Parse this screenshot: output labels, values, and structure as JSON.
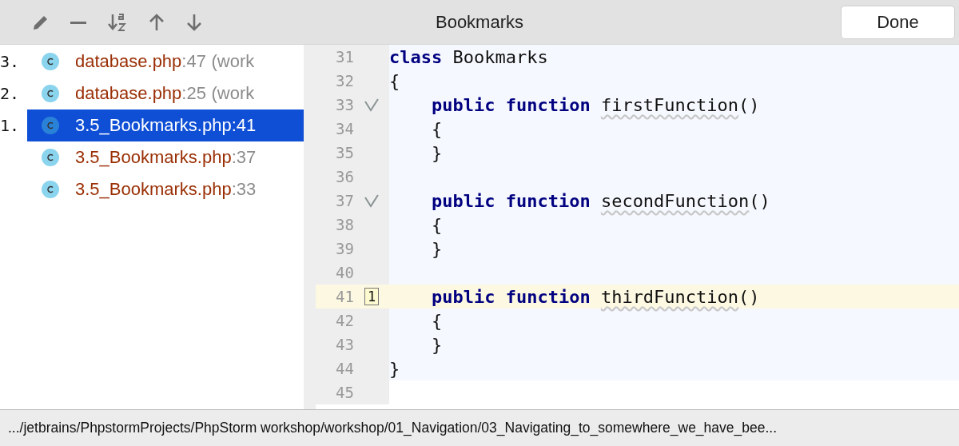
{
  "window": {
    "title": "Bookmarks"
  },
  "toolbar": [
    {
      "kind": "edit"
    },
    {
      "kind": "remove"
    },
    {
      "kind": "sort"
    },
    {
      "kind": "up"
    },
    {
      "kind": "down"
    }
  ],
  "done_button": "Done",
  "bookmarks": [
    {
      "mnemonic": "3.",
      "file": "database.php",
      "line": ":47",
      "context": "(work",
      "selected": false
    },
    {
      "mnemonic": "2.",
      "file": "database.php",
      "line": ":25",
      "context": "(work",
      "selected": false
    },
    {
      "mnemonic": "1.",
      "file": "3.5_Bookmarks.php",
      "line": ":41",
      "selected": true
    },
    {
      "file": "3.5_Bookmarks.php",
      "line": ":37",
      "selected": false
    },
    {
      "file": "3.5_Bookmarks.php",
      "line": ":33",
      "selected": false
    }
  ],
  "editor": {
    "lines": [
      {
        "number": "31",
        "indent": false,
        "tokens": [
          {
            "kind": "keyword",
            "text": "class"
          },
          {
            "kind": "name",
            "text": "Bookmarks"
          }
        ]
      },
      {
        "number": "32",
        "indent": false,
        "tokens": [
          {
            "kind": "plain",
            "text": "{"
          }
        ]
      },
      {
        "number": "33",
        "indent": true,
        "marker": {
          "kind": "check"
        },
        "tokens": [
          {
            "kind": "keyword",
            "text": "public function"
          },
          {
            "kind": "fn",
            "text": "firstFunction"
          },
          {
            "kind": "plain",
            "text": "()"
          }
        ]
      },
      {
        "number": "34",
        "indent": true,
        "tokens": [
          {
            "kind": "plain",
            "text": "{"
          }
        ]
      },
      {
        "number": "35",
        "indent": true,
        "tokens": [
          {
            "kind": "plain",
            "text": "}"
          }
        ]
      },
      {
        "number": "36"
      },
      {
        "number": "37",
        "indent": true,
        "marker": {
          "kind": "check"
        },
        "tokens": [
          {
            "kind": "keyword",
            "text": "public function"
          },
          {
            "kind": "fn",
            "text": "secondFunction"
          },
          {
            "kind": "plain",
            "text": "()"
          }
        ]
      },
      {
        "number": "38",
        "indent": true,
        "tokens": [
          {
            "kind": "plain",
            "text": "{"
          }
        ]
      },
      {
        "number": "39",
        "indent": true,
        "tokens": [
          {
            "kind": "plain",
            "text": "}"
          }
        ]
      },
      {
        "number": "40"
      },
      {
        "number": "41",
        "indent": true,
        "current": true,
        "marker": {
          "kind": "bookmark",
          "label": "1"
        },
        "tokens": [
          {
            "kind": "keyword",
            "text": "public function"
          },
          {
            "kind": "fn",
            "text": "thirdFunction"
          },
          {
            "kind": "plain",
            "text": "()"
          }
        ]
      },
      {
        "number": "42",
        "indent": true,
        "tokens": [
          {
            "kind": "plain",
            "text": "{"
          }
        ]
      },
      {
        "number": "43",
        "indent": true,
        "tokens": [
          {
            "kind": "plain",
            "text": "}"
          }
        ]
      },
      {
        "number": "44",
        "indent": false,
        "tokens": [
          {
            "kind": "plain",
            "text": "}"
          }
        ]
      },
      {
        "number": "45"
      }
    ]
  },
  "status_bar": ".../jetbrains/PhpstormProjects/PhpStorm workshop/workshop/01_Navigation/03_Navigating_to_somewhere_we_have_bee..."
}
